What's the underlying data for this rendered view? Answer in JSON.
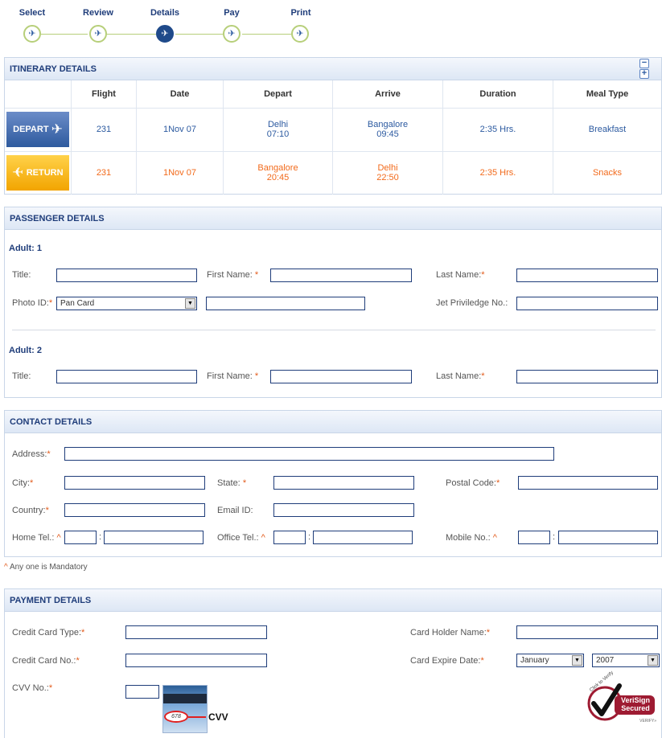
{
  "steps": [
    {
      "label": "Select",
      "active": false
    },
    {
      "label": "Review",
      "active": false
    },
    {
      "label": "Details",
      "active": true
    },
    {
      "label": "Pay",
      "active": false
    },
    {
      "label": "Print",
      "active": false
    }
  ],
  "itinerary": {
    "title": "ITINERARY DETAILS",
    "collapse_icon": "minus-icon",
    "expand_icon": "plus-icon",
    "columns": [
      "Flight",
      "Date",
      "Depart",
      "Arrive",
      "Duration",
      "Meal Type"
    ],
    "rows": [
      {
        "badge": "DEPART",
        "flight": "231",
        "date": "1Nov 07",
        "depart_city": "Delhi",
        "depart_time": "07:10",
        "arrive_city": "Bangalore",
        "arrive_time": "09:45",
        "duration": "2:35 Hrs.",
        "meal": "Breakfast"
      },
      {
        "badge": "RETURN",
        "flight": "231",
        "date": "1Nov 07",
        "depart_city": "Bangalore",
        "depart_time": "20:45",
        "arrive_city": "Delhi",
        "arrive_time": "22:50",
        "duration": "2:35 Hrs.",
        "meal": "Snacks"
      }
    ]
  },
  "passenger": {
    "title": "PASSENGER DETAILS",
    "adult1": "Adult: 1",
    "adult2": "Adult: 2",
    "title_label": "Title:",
    "first_name_label": "First Name:",
    "last_name_label": "Last Name:",
    "photo_id_label": "Photo ID:",
    "photo_id_value": "Pan Card",
    "jet_label": "Jet Priviledge No.:",
    "required_mark": "*"
  },
  "contact": {
    "title": "CONTACT DETAILS",
    "address_label": "Address:",
    "city_label": "City:",
    "state_label": "State:",
    "postal_label": "Postal Code:",
    "country_label": "Country:",
    "email_label": "Email ID:",
    "home_tel_label": "Home Tel.:",
    "office_tel_label": "Office Tel.:",
    "mobile_label": "Mobile No.:",
    "caret_mark": "^",
    "separator": ":",
    "mandatory_note": "Any one is Mandatory"
  },
  "payment": {
    "title": "PAYMENT DETAILS",
    "card_type_label": "Credit Card Type:",
    "card_no_label": "Credit Card No.:",
    "cvv_label": "CVV No.:",
    "holder_label": "Card Holder Name:",
    "expire_label": "Card Expire Date:",
    "expire_month": "January",
    "expire_year": "2007",
    "cvv_sample": "678",
    "cvv_text": "CVV",
    "verisign_line1": "VeriSign",
    "verisign_line2": "Secured",
    "verisign_line3": "VERIFY»",
    "verisign_click": "Click to Verify"
  }
}
